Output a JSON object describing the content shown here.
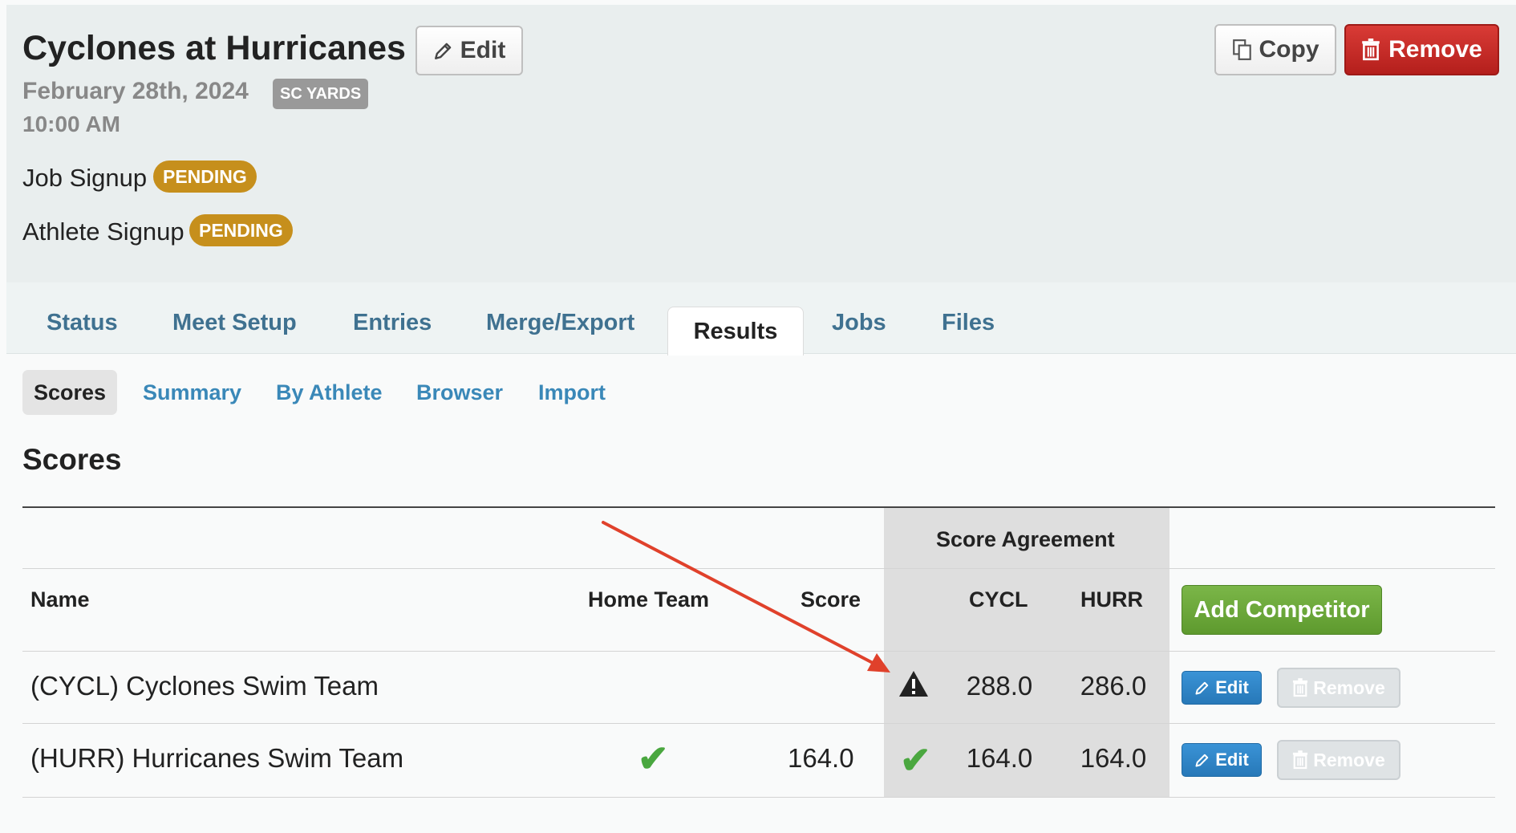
{
  "meet": {
    "title": "Cyclones at Hurricanes",
    "edit_label": "Edit",
    "date": "February 28th, 2024",
    "course": "SC YARDS",
    "time": "10:00 AM",
    "copy_label": "Copy",
    "remove_label": "Remove"
  },
  "signups": [
    {
      "label": "Job Signup",
      "status": "PENDING"
    },
    {
      "label": "Athlete Signup",
      "status": "PENDING"
    }
  ],
  "tabs": [
    {
      "label": "Status"
    },
    {
      "label": "Meet Setup"
    },
    {
      "label": "Entries"
    },
    {
      "label": "Merge/Export"
    },
    {
      "label": "Results",
      "active": true
    },
    {
      "label": "Jobs"
    },
    {
      "label": "Files"
    }
  ],
  "subtabs": [
    {
      "label": "Scores",
      "active": true
    },
    {
      "label": "Summary"
    },
    {
      "label": "By Athlete"
    },
    {
      "label": "Browser"
    },
    {
      "label": "Import"
    }
  ],
  "scores": {
    "title": "Scores",
    "group_header": "Score Agreement",
    "columns": {
      "name": "Name",
      "home": "Home Team",
      "score": "Score",
      "cycl": "CYCL",
      "hurr": "HURR"
    },
    "add_label": "Add Competitor",
    "rows": [
      {
        "name": "(CYCL) Cyclones Swim Team",
        "home_team": false,
        "score": "",
        "agreement": "warning",
        "cycl": "288.0",
        "hurr": "286.0",
        "edit_label": "Edit",
        "remove_label": "Remove"
      },
      {
        "name": "(HURR) Hurricanes Swim Team",
        "home_team": true,
        "score": "164.0",
        "agreement": "agree",
        "cycl": "164.0",
        "hurr": "164.0",
        "edit_label": "Edit",
        "remove_label": "Remove"
      }
    ]
  },
  "colors": {
    "tab_link": "#3f7190",
    "subtab_link": "#3a88b8",
    "pending": "#c68f1c",
    "remove": "#c62d29",
    "add_competitor": "#6aa73a",
    "edit_small": "#2f86c8",
    "check": "#4aa73f",
    "arrow": "#e0412b"
  },
  "icons": [
    "pencil-icon",
    "copy-icon",
    "trash-icon",
    "warning-icon",
    "check-icon",
    "arrow-annotation"
  ]
}
